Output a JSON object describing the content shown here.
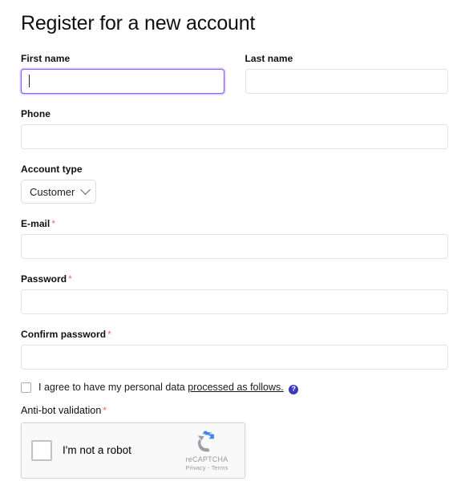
{
  "page": {
    "title": "Register for a new account"
  },
  "fields": {
    "first_name": {
      "label": "First name",
      "value": "",
      "placeholder": "",
      "focused": true
    },
    "last_name": {
      "label": "Last name",
      "value": "",
      "placeholder": ""
    },
    "phone": {
      "label": "Phone",
      "value": "",
      "placeholder": ""
    },
    "account_type": {
      "label": "Account type",
      "selected": "Customer",
      "chevron_icon": "chevron-down-icon"
    },
    "email": {
      "label": "E-mail",
      "required_marker": "*",
      "value": "",
      "placeholder": ""
    },
    "password": {
      "label": "Password",
      "required_marker": "*",
      "value": "",
      "placeholder": ""
    },
    "confirm_password": {
      "label": "Confirm password",
      "required_marker": "*",
      "value": "",
      "placeholder": ""
    },
    "antibot": {
      "label": "Anti-bot validation",
      "required_marker": "*"
    }
  },
  "consent": {
    "checked": false,
    "text_before": "I agree to have my personal data",
    "link_text": "processed as follows.",
    "help_icon": "question-mark-help-icon",
    "help_glyph": "?"
  },
  "recaptcha": {
    "checkbox_name": "recaptcha-checkbox",
    "label": "I'm not a robot",
    "brand": "reCAPTCHA",
    "legal": "Privacy - Terms",
    "logo_icon": "recaptcha-logo-icon"
  },
  "colors": {
    "focus_border": "#8b5cf6",
    "focus_glow": "#d8c8fb",
    "required_asterisk": "#e8705f",
    "help_icon_bg": "#3b39bd",
    "input_border": "#e3e3e3",
    "recaptcha_blue": "#4285f4",
    "recaptcha_grey": "#9aa0a6"
  }
}
